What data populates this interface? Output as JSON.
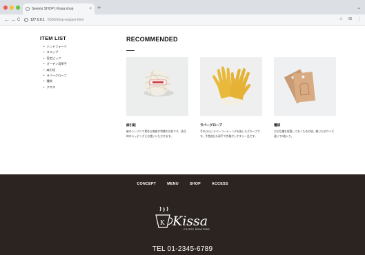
{
  "browser": {
    "tab_title": "Sweets SHOP | Kissa shop",
    "new_tab_symbol": "+",
    "tab_close_symbol": "×",
    "back_symbol": "←",
    "forward_symbol": "→",
    "reload_symbol": "C",
    "url_host": "127.0.0.1",
    "url_path": ":5500/shop-wapper.html",
    "colors": {
      "close": "#ee5b55",
      "minimize": "#f5bd3a",
      "maximize": "#5fc73f"
    }
  },
  "sidebar": {
    "title": "ITEM LIST",
    "items": [
      {
        "label": "ハンドフォーク"
      },
      {
        "label": "スコップ"
      },
      {
        "label": "剪定ピック"
      },
      {
        "label": "ガーデン用革手"
      },
      {
        "label": "麻引紐"
      },
      {
        "label": "ラバーグローブ"
      },
      {
        "label": "種袋"
      },
      {
        "label": "クロス"
      }
    ]
  },
  "main": {
    "heading": "RECOMMENDED",
    "products": [
      {
        "name": "麻引紐",
        "description": "麻のシンプルで素朴な質感が特徴の引紐です。多目的のラッピングにお使いいただけます。",
        "image": "twine-ball"
      },
      {
        "name": "ラバーグローブ",
        "description": "手のひらにラバーコーティングを施したグローブです。手首部分も厚手で作業がしやすい一品です。",
        "image": "rubber-gloves"
      },
      {
        "name": "種袋",
        "description": "大切な種を保管しておくための袋。軽いためサイズ違いで3枚入り。",
        "image": "seed-tags"
      }
    ]
  },
  "footer": {
    "nav": [
      {
        "label": "CONCEPT"
      },
      {
        "label": "MENU"
      },
      {
        "label": "SHOP"
      },
      {
        "label": "ACCESS"
      }
    ],
    "logo_text": "Kissa",
    "logo_sub": "COFFEE ROASTERS",
    "tel": "TEL 01-2345-6789",
    "background": "#2b2421"
  }
}
